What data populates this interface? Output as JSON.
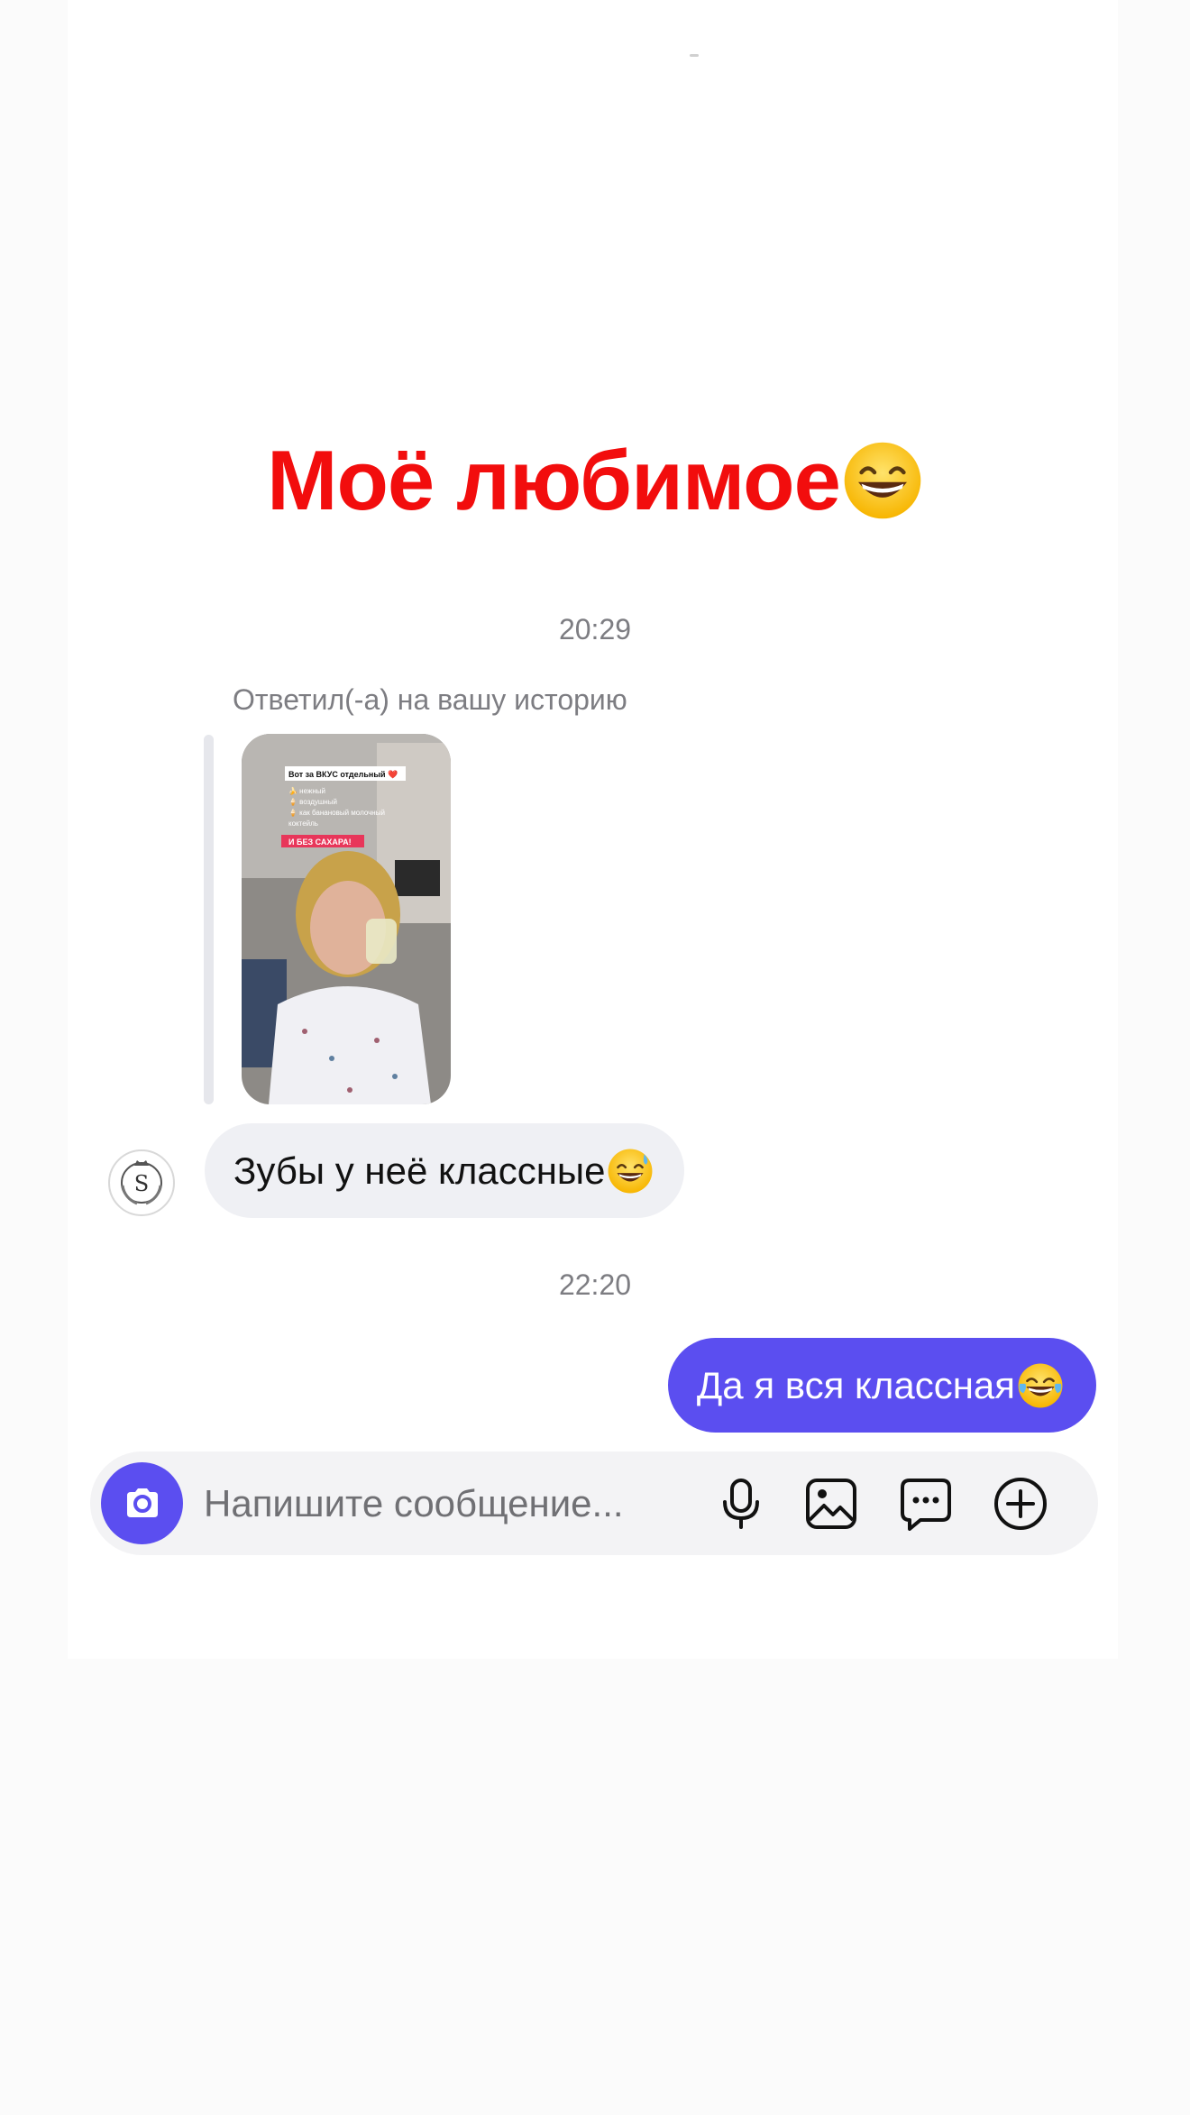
{
  "story_caption": {
    "text": "Моё любимое",
    "emoji": "grinning-face-with-smiling-eyes"
  },
  "chat": {
    "time_1": "20:29",
    "reply_label": "Ответил(-а) на вашу историю",
    "story_preview": {
      "header": "Вот за ВКУС отдельный ❤️",
      "lines": [
        "🍌 нежный",
        "🍦 воздушный",
        "🍦 как банановый молочный",
        "коктейль"
      ],
      "tag": "И БЕЗ САХАРА!"
    },
    "incoming_message": {
      "text": "Зубы у неё классные",
      "emoji": "grinning-face-with-sweat"
    },
    "time_2": "22:20",
    "outgoing_message": {
      "text": "Да я вся классная",
      "emoji": "face-with-tears-of-joy"
    }
  },
  "composer": {
    "placeholder": "Напишите сообщение...",
    "icons": [
      "camera-icon",
      "microphone-icon",
      "gallery-icon",
      "sticker-icon",
      "add-icon"
    ]
  },
  "colors": {
    "accent": "#5b4ef0",
    "caption": "#f20d0d",
    "incoming_bubble": "#eff0f4",
    "timestamp": "#7d7d82"
  }
}
